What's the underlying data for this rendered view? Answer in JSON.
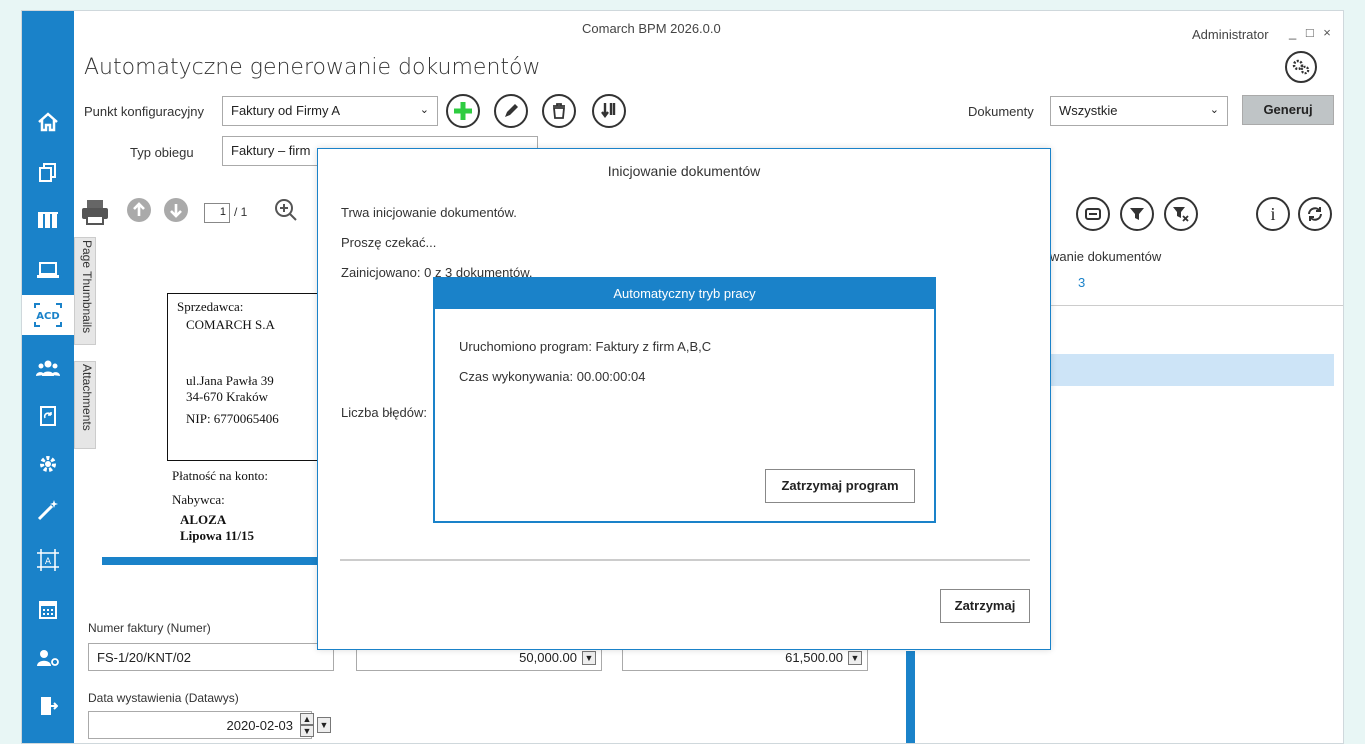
{
  "window": {
    "title": "Comarch BPM 2026.0.0",
    "user": "Administrator",
    "controls": "_ □ ×"
  },
  "page": {
    "title": "Automatyczne generowanie dokumentów"
  },
  "config": {
    "label": "Punkt konfiguracyjny",
    "value": "Faktury od Firmy A"
  },
  "type": {
    "label": "Typ obiegu",
    "value": "Faktury – firm"
  },
  "documents": {
    "label": "Dokumenty",
    "value": "Wszystkie",
    "generate": "Generuj"
  },
  "pager": {
    "current": "1",
    "total": "/ 1"
  },
  "sidebar": [
    "home-icon",
    "documents-icon",
    "library-icon",
    "laptop-icon",
    "acd-icon",
    "users-icon",
    "refresh-doc-icon",
    "settings-icon",
    "wand-icon",
    "ocr-icon",
    "calendar-icon",
    "user-key-icon",
    "exit-icon"
  ],
  "tabs": {
    "thumbnails": "Page Thumbnails",
    "attachments": "Attachments"
  },
  "invoice": {
    "seller_label": "Sprzedawca:",
    "seller": "COMARCH S.A",
    "street": "ul.Jana Pawła 39",
    "city": "34-670 Kraków",
    "nip": "NIP: 6770065406",
    "payment": "Płatność na konto:",
    "buyer_label": "Nabywca:",
    "buyer": "ALOZA",
    "buyer_street": "Lipowa 11/15"
  },
  "form": {
    "number_label": "Numer faktury (Numer)",
    "number": "FS-1/20/KNT/02",
    "net": "50,000.00",
    "gross": "61,500.00",
    "date_label": "Data wystawienia (Datawys)",
    "date": "2020-02-03"
  },
  "right": {
    "heading": "wanie dokumentów",
    "count": "3"
  },
  "dialog1": {
    "title": "Inicjowanie dokumentów",
    "line1": "Trwa inicjowanie dokumentów.",
    "line2": "Proszę czekać...",
    "line3": "Zainicjowano: 0 z 3 dokumentów.",
    "errors": "Liczba błędów:",
    "stop": "Zatrzymaj"
  },
  "dialog2": {
    "title": "Automatyczny tryb pracy",
    "program": "Uruchomiono program: Faktury z firm A,B,C",
    "time": "Czas wykonywania:  00.00:00:04",
    "stop": "Zatrzymaj program"
  }
}
